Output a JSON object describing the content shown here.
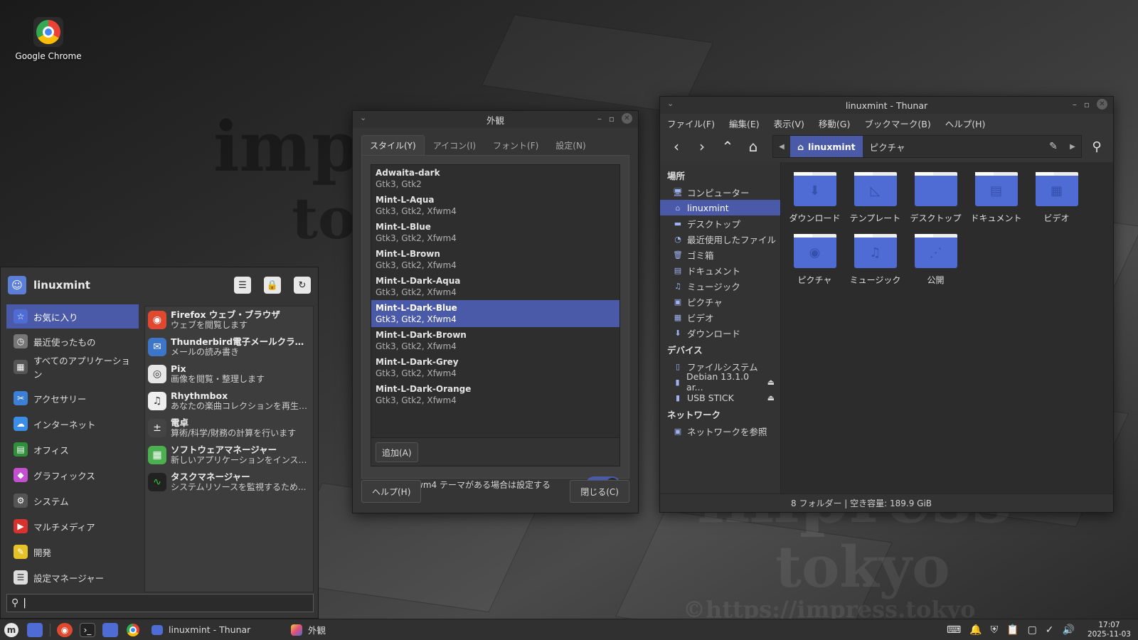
{
  "desktop": {
    "icons": [
      {
        "label": "Google Chrome"
      }
    ],
    "watermark": {
      "line1": "impress",
      "line2": "tokyo",
      "url": "©https://impress.tokyo"
    }
  },
  "appearance": {
    "title": "外観",
    "tabs": [
      "スタイル(Y)",
      "アイコン(I)",
      "フォント(F)",
      "設定(N)"
    ],
    "themes": [
      {
        "name": "Adwaita-dark",
        "desc": "Gtk3, Gtk2"
      },
      {
        "name": "Mint-L-Aqua",
        "desc": "Gtk3, Gtk2, Xfwm4"
      },
      {
        "name": "Mint-L-Blue",
        "desc": "Gtk3, Gtk2, Xfwm4"
      },
      {
        "name": "Mint-L-Brown",
        "desc": "Gtk3, Gtk2, Xfwm4"
      },
      {
        "name": "Mint-L-Dark-Aqua",
        "desc": "Gtk3, Gtk2, Xfwm4"
      },
      {
        "name": "Mint-L-Dark-Blue",
        "desc": "Gtk3, Gtk2, Xfwm4"
      },
      {
        "name": "Mint-L-Dark-Brown",
        "desc": "Gtk3, Gtk2, Xfwm4"
      },
      {
        "name": "Mint-L-Dark-Grey",
        "desc": "Gtk3, Gtk2, Xfwm4"
      },
      {
        "name": "Mint-L-Dark-Orange",
        "desc": "Gtk3, Gtk2, Xfwm4"
      }
    ],
    "selected_theme": "Mint-L-Dark-Blue",
    "add_label": "追加(A)",
    "toggle_label": "一致する Xfwm4 テーマがある場合は設定する",
    "toggle_on": true,
    "help_label": "ヘルプ(H)",
    "close_label": "閉じる(C)"
  },
  "thunar": {
    "title": "linuxmint - Thunar",
    "menu": [
      "ファイル(F)",
      "編集(E)",
      "表示(V)",
      "移動(G)",
      "ブックマーク(B)",
      "ヘルプ(H)"
    ],
    "path": [
      "linuxmint",
      "ピクチャ"
    ],
    "side": {
      "places_heading": "場所",
      "places": [
        "コンピューター",
        "linuxmint",
        "デスクトップ",
        "最近使用したファイル",
        "ゴミ箱",
        "ドキュメント",
        "ミュージック",
        "ピクチャ",
        "ビデオ",
        "ダウンロード"
      ],
      "devices_heading": "デバイス",
      "devices": [
        "ファイルシステム",
        "Debian 13.1.0 ar...",
        "USB STICK"
      ],
      "network_heading": "ネットワーク",
      "network": [
        "ネットワークを参照"
      ]
    },
    "folders": [
      "ダウンロード",
      "テンプレート",
      "デスクトップ",
      "ドキュメント",
      "ビデオ",
      "ピクチャ",
      "ミュージック",
      "公開"
    ],
    "status": "8 フォルダー  |  空き容量: 189.9 GiB"
  },
  "menu": {
    "user": "linuxmint",
    "categories": [
      "お気に入り",
      "最近使ったもの",
      "すべてのアプリケーション",
      "アクセサリー",
      "インターネット",
      "オフィス",
      "グラフィックス",
      "システム",
      "マルチメディア",
      "開発",
      "設定マネージャー"
    ],
    "apps": [
      {
        "title": "Firefox ウェブ・ブラウザ",
        "desc": "ウェブを閲覧します"
      },
      {
        "title": "Thunderbird電子メールクライア...",
        "desc": "メールの読み書き"
      },
      {
        "title": "Pix",
        "desc": "画像を閲覧・整理します"
      },
      {
        "title": "Rhythmbox",
        "desc": "あなたの楽曲コレクションを再生、..."
      },
      {
        "title": "電卓",
        "desc": "算術/科学/財務の計算を行います"
      },
      {
        "title": "ソフトウェアマネージャー",
        "desc": "新しいアプリケーションをインスト..."
      },
      {
        "title": "タスクマネージャー",
        "desc": "システムリソースを監視するため..."
      }
    ],
    "search_value": ""
  },
  "taskbar": {
    "tasks": [
      "linuxmint - Thunar",
      "外観"
    ],
    "time": "17:07",
    "date": "2025-11-03"
  },
  "colors": {
    "accent": "#4a5aa8",
    "folder": "#4e6cd4"
  }
}
